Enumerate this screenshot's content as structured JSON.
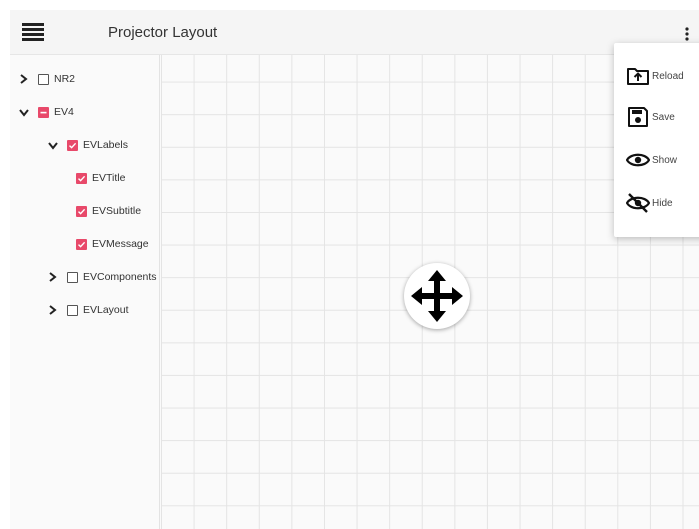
{
  "header": {
    "title": "Projector Layout",
    "menu_icon": "hamburger-menu-icon",
    "overflow_icon": "more-vert-icon"
  },
  "tree": [
    {
      "label": "NR2",
      "expanded": false,
      "state": "unchecked"
    },
    {
      "label": "EV4",
      "expanded": true,
      "state": "indeterminate"
    },
    {
      "label": "EVLabels",
      "expanded": true,
      "state": "checked"
    },
    {
      "label": "EVTitle",
      "state": "checked"
    },
    {
      "label": "EVSubtitle",
      "state": "checked"
    },
    {
      "label": "EVMessage",
      "state": "checked"
    },
    {
      "label": "EVComponents",
      "expanded": false,
      "state": "unchecked"
    },
    {
      "label": "EVLayout",
      "expanded": false,
      "state": "unchecked"
    }
  ],
  "menu": {
    "items": [
      {
        "label": "Reload",
        "icon": "folder-upload-icon"
      },
      {
        "label": "Save",
        "icon": "floppy-disk-icon"
      },
      {
        "label": "Show",
        "icon": "eye-icon"
      },
      {
        "label": "Hide",
        "icon": "eye-off-icon"
      }
    ]
  },
  "canvas": {
    "move_icon": "move-arrows-icon"
  },
  "colors": {
    "accent": "#e8496a",
    "header_bg": "#f5f5f5",
    "grid_line": "#e4e4e4"
  }
}
